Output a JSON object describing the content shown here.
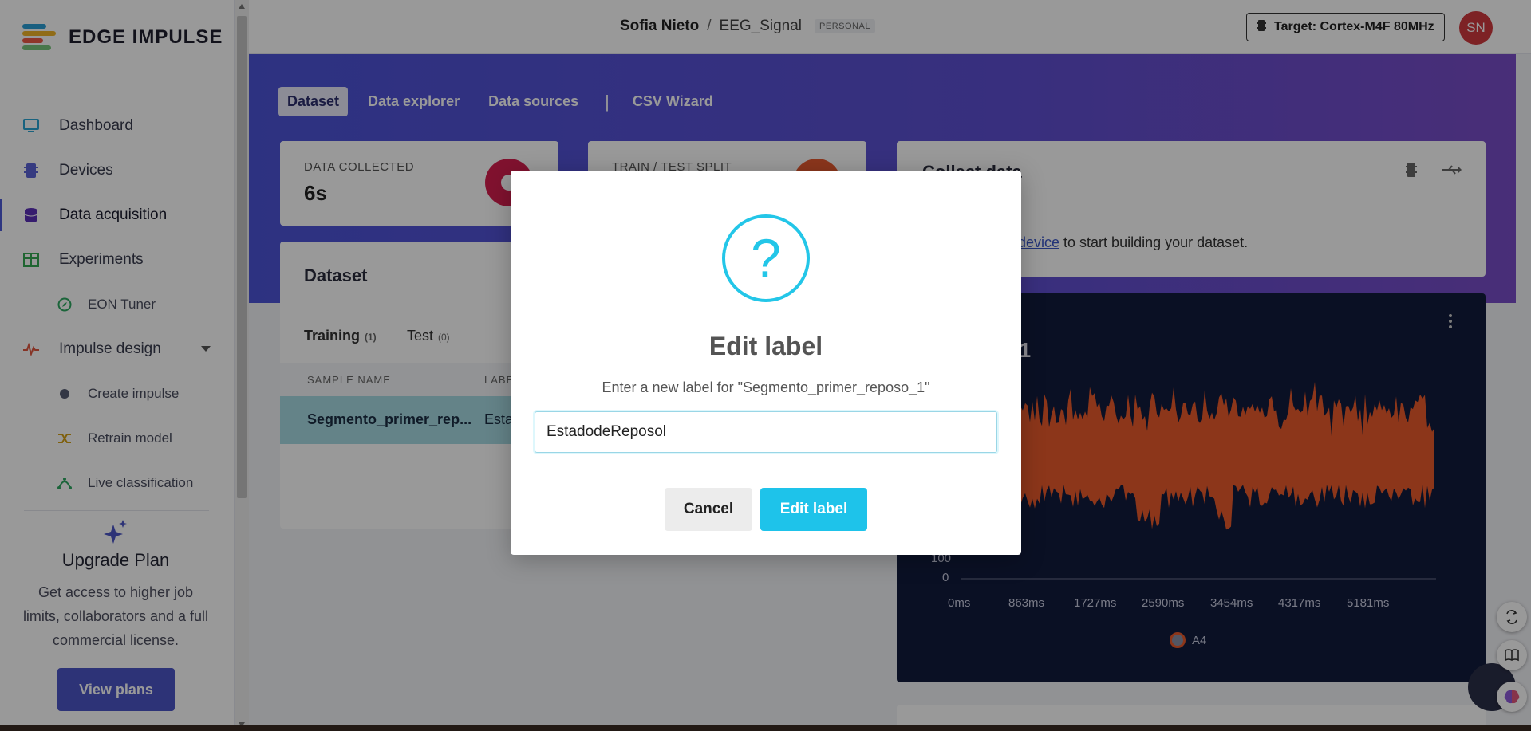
{
  "app": {
    "logo_text": "EDGE IMPULSE"
  },
  "sidebar": {
    "items": [
      {
        "label": "Dashboard",
        "icon": "monitor-icon"
      },
      {
        "label": "Devices",
        "icon": "chip-icon"
      },
      {
        "label": "Data acquisition",
        "icon": "database-icon"
      },
      {
        "label": "Experiments",
        "icon": "table-icon"
      },
      {
        "label": "EON Tuner",
        "icon": "compass-icon"
      },
      {
        "label": "Impulse design",
        "icon": "pulse-icon"
      },
      {
        "label": "Create impulse",
        "icon": "dot-icon"
      },
      {
        "label": "Retrain model",
        "icon": "shuffle-icon"
      },
      {
        "label": "Live classification",
        "icon": "classification-icon"
      }
    ],
    "upgrade": {
      "title": "Upgrade Plan",
      "text": "Get access to higher job limits, collaborators and a full commercial license.",
      "button": "View plans"
    }
  },
  "topbar": {
    "user": "Sofia Nieto",
    "separator": "/",
    "project": "EEG_Signal",
    "badge": "PERSONAL",
    "target": "Target: Cortex-M4F 80MHz",
    "avatar": "SN"
  },
  "main": {
    "tabs": [
      "Dataset",
      "Data explorer",
      "Data sources",
      "CSV Wizard"
    ],
    "tab_separator": "|",
    "data_collected_label": "DATA COLLECTED",
    "data_collected_value": "6s",
    "split_label": "TRAIN / TEST SPLIT",
    "collect_title": "Collect data",
    "collect_link": "device",
    "collect_text": " to start building your dataset.",
    "dataset_title": "Dataset",
    "ds_tabs": [
      {
        "label": "Training",
        "count": "(1)"
      },
      {
        "label": "Test",
        "count": "(0)"
      }
    ],
    "columns": [
      "SAMPLE NAME",
      "LABEL"
    ],
    "row": {
      "name": "Segmento_primer_rep...",
      "label": "Estad"
    }
  },
  "chart": {
    "title": "_r11",
    "x_ticks": [
      "0ms",
      "863ms",
      "1727ms",
      "2590ms",
      "3454ms",
      "4317ms",
      "5181ms"
    ],
    "y_ticks": [
      "100",
      "0"
    ],
    "legend": "A4",
    "color": "#ea5b2c"
  },
  "modal": {
    "title": "Edit label",
    "subtitle": "Enter a new label for \"Segmento_primer_reposo_1\"",
    "input_value": "EstadodeReposol",
    "cancel": "Cancel",
    "confirm": "Edit label"
  },
  "colors": {
    "accent": "#1ec3ea",
    "brand": "#4b55c6",
    "avatar": "#d0393e"
  }
}
